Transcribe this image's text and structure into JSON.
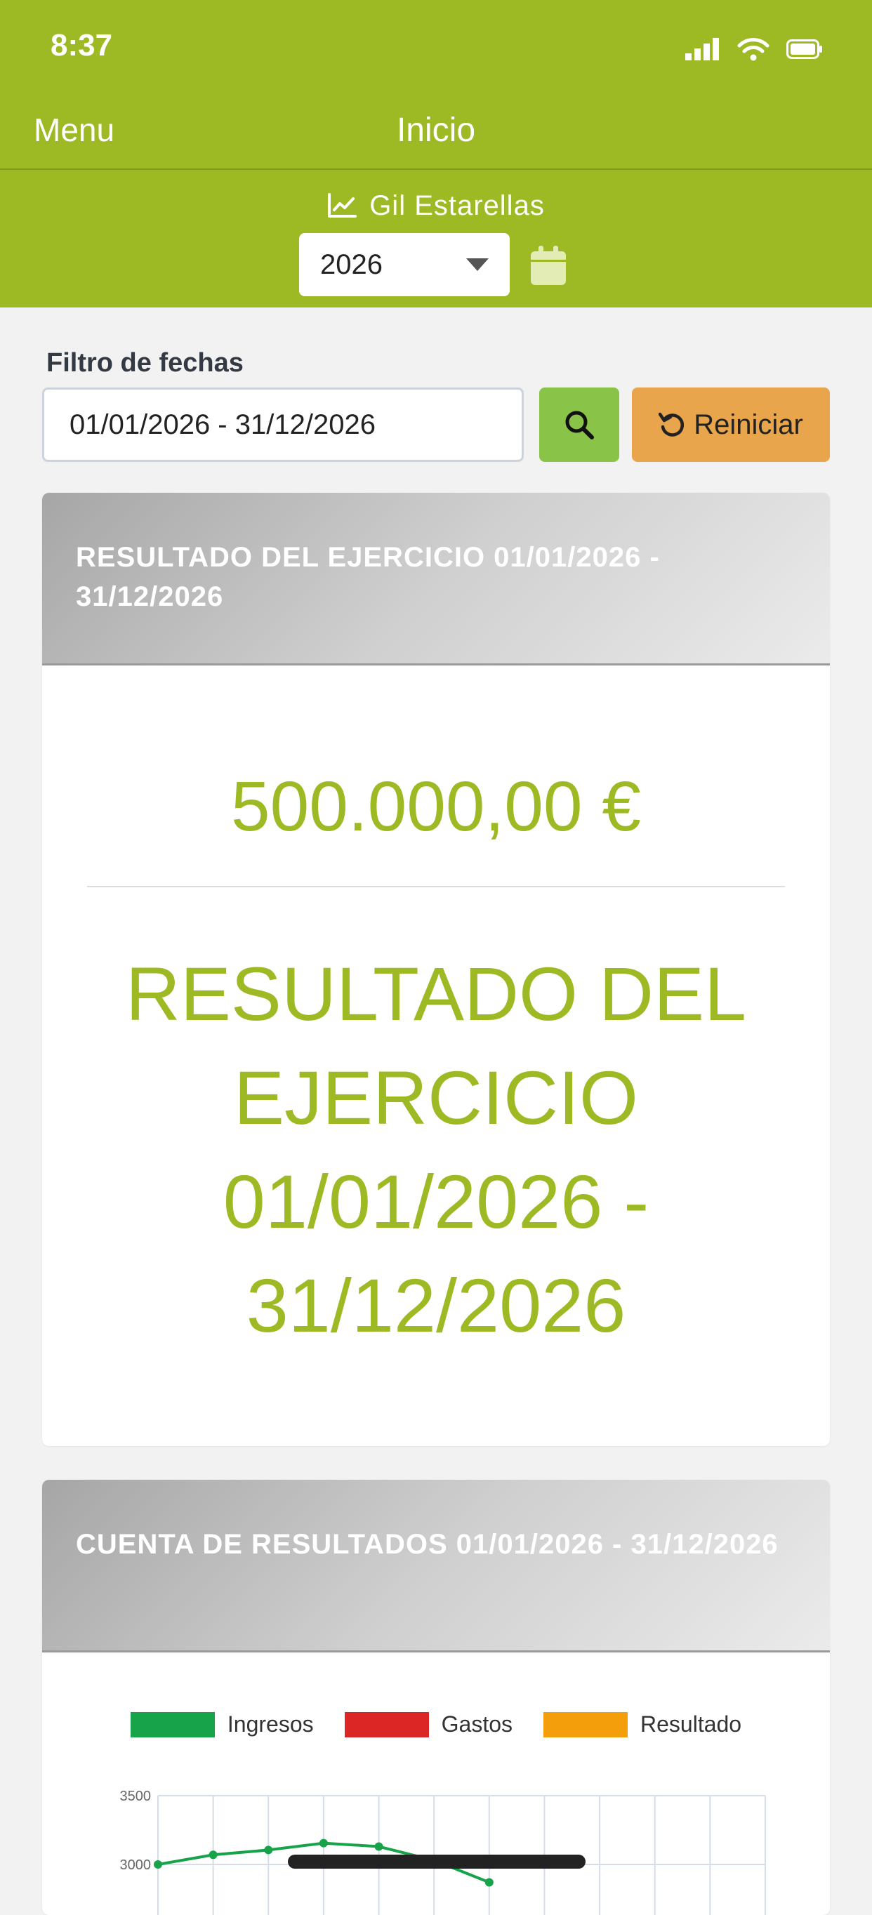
{
  "status_bar": {
    "time": "8:37"
  },
  "nav": {
    "menu_label": "Menu",
    "title": "Inicio"
  },
  "company": {
    "name": "Gil Estarellas",
    "icon": "line-chart-icon"
  },
  "year_select": {
    "value": "2026"
  },
  "filter": {
    "label": "Filtro de fechas",
    "date_range": "01/01/2026 - 31/12/2026",
    "reset_label": "Reiniciar"
  },
  "result_card": {
    "title": "RESULTADO DEL EJERCICIO 01/01/2026 - 31/12/2026",
    "amount": "500.000,00 €",
    "caption": "RESULTADO DEL EJERCICIO 01/01/2026 - 31/12/2026"
  },
  "accounts_card": {
    "title": "CUENTA DE RESULTADOS 01/01/2026 - 31/12/2026"
  },
  "colors": {
    "brand_green": "#9dba24",
    "search_green": "#89c347",
    "reset_orange": "#e8a54b"
  },
  "chart_data": {
    "type": "line",
    "legend": [
      "Ingresos",
      "Gastos",
      "Resultado"
    ],
    "legend_colors": [
      "#16a34a",
      "#dc2626",
      "#f59e0b"
    ],
    "y_ticks": [
      "3500",
      "3000"
    ],
    "ylim": [
      2800,
      3500
    ],
    "x": [
      1,
      2,
      3,
      4,
      5,
      6,
      7,
      8,
      9,
      10,
      11,
      12
    ],
    "series": [
      {
        "name": "Ingresos",
        "color": "#16a34a",
        "values": [
          3000,
          3070,
          3105,
          3155,
          3130,
          3030,
          2870
        ]
      }
    ]
  }
}
